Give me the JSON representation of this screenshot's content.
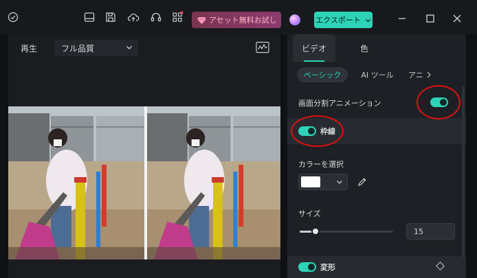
{
  "titlebar": {
    "asset_button_label": "アセット無料お試し",
    "export_button_label": "エクスポート",
    "accent_color": "#2ed3b7",
    "icons": [
      "check-circle-icon",
      "layout-icon",
      "save-icon",
      "cloud-upload-icon",
      "headset-icon",
      "grid-icon",
      "gem-icon",
      "avatar",
      "chevron-down-icon",
      "minimize-icon",
      "maximize-icon",
      "close-icon"
    ]
  },
  "preview": {
    "play_label": "再生",
    "quality_value": "フル品質"
  },
  "inspector": {
    "tabs": [
      {
        "label": "ビデオ",
        "active": true
      },
      {
        "label": "色",
        "active": false
      }
    ],
    "subtabs": [
      {
        "label": "ベーシック",
        "active": true
      },
      {
        "label": "AI ツール",
        "active": false
      },
      {
        "label": "アニ",
        "active": false
      }
    ],
    "split_screen_animation": {
      "label": "画面分割アニメーション",
      "on": true
    },
    "border": {
      "label": "枠線",
      "on": true
    },
    "color_select_label": "カラーを選択",
    "selected_color": "#ffffff",
    "size": {
      "label": "サイズ",
      "value": "15",
      "level": 0.17
    },
    "transform": {
      "label": "変形",
      "on": true
    }
  }
}
